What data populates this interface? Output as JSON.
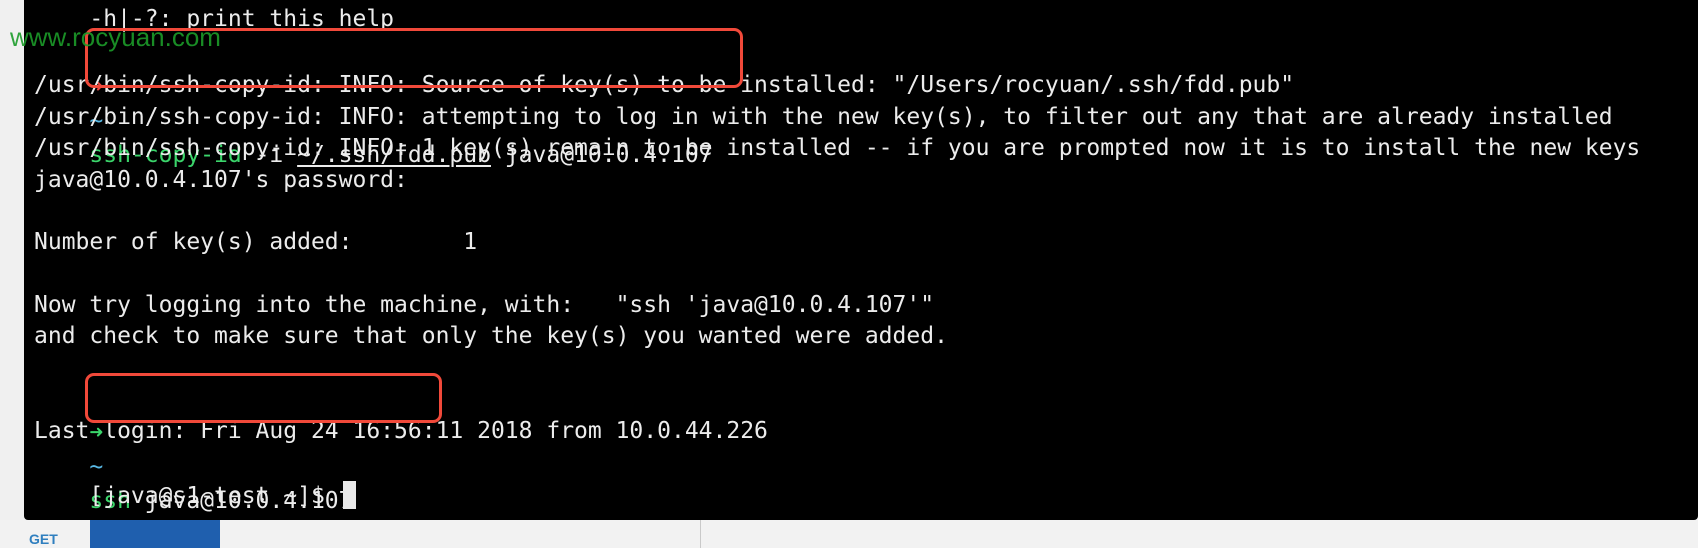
{
  "terminal": {
    "partial_help_line": "    -h|-?: print this help",
    "first_command": {
      "arrow": "➜",
      "tilde": "~",
      "cmd": "ssh-copy-id",
      "flag": " -i ",
      "keyfile": "~/.ssh/fdd.pub",
      "target": " java@10.0.4.107"
    },
    "output_lines": [
      "/usr/bin/ssh-copy-id: INFO: Source of key(s) to be installed: \"/Users/rocyuan/.ssh/fdd.pub\"",
      "/usr/bin/ssh-copy-id: INFO: attempting to log in with the new key(s), to filter out any that are already installed",
      "/usr/bin/ssh-copy-id: INFO: 1 key(s) remain to be installed -- if you are prompted now it is to install the new keys",
      "java@10.0.4.107's password:",
      "",
      "Number of key(s) added:        1",
      "",
      "Now try logging into the machine, with:   \"ssh 'java@10.0.4.107'\"",
      "and check to make sure that only the key(s) you wanted were added."
    ],
    "second_command": {
      "arrow": "➜",
      "tilde": "~",
      "cmd": "ssh",
      "target": " java@10.0.4.107"
    },
    "last_login": "Last login: Fri Aug 24 16:56:11 2018 from 10.0.44.226",
    "prompt": "[java@s1-test ~]$ "
  },
  "watermark": "www.rocyuan.com",
  "background_app": {
    "method_label": "GET"
  },
  "colors": {
    "terminal_bg": "#000000",
    "text": "#ececec",
    "command_green": "#3bd56b",
    "prompt_arrow_red": "#e64a43",
    "highlight_border": "#f1493a",
    "watermark_green": "#1c9c2a"
  }
}
